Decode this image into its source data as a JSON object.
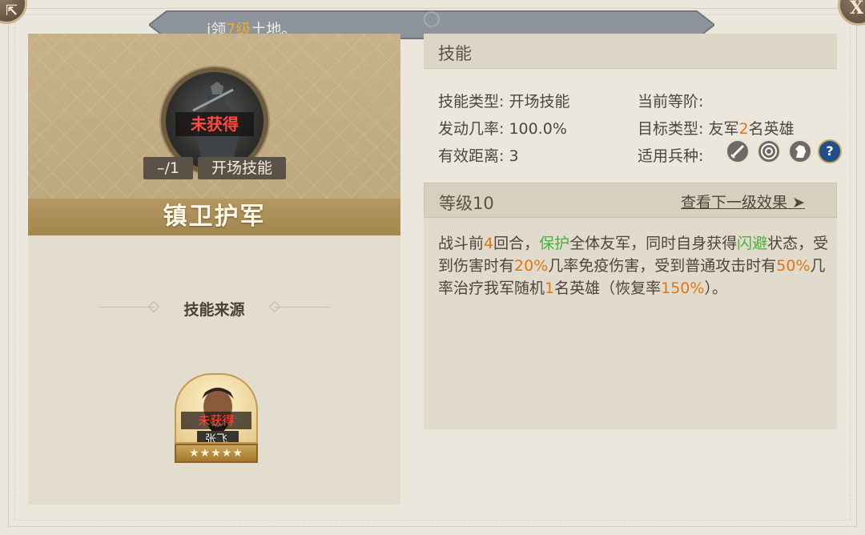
{
  "banner": {
    "prefix": "i领",
    "level": "7级",
    "suffix": "土地。"
  },
  "corner": {
    "left_glyph": "⇱",
    "right_glyph": "X"
  },
  "skill": {
    "name": "镇卫护军",
    "status": "未获得",
    "count": "–/1",
    "type_tag": "开场技能"
  },
  "source": {
    "label": "技能来源",
    "hero": {
      "name": "张飞",
      "status": "未获得",
      "stars": "★★★★★"
    }
  },
  "panel": {
    "header": "技能",
    "skill_type_label": "技能类型:",
    "skill_type_value": "开场技能",
    "rate_label": "发动几率:",
    "rate_value": "100.0%",
    "range_label": "有效距离:",
    "range_value": "3",
    "rank_label": "当前等阶:",
    "target_label": "目标类型:",
    "target_pre": "友军",
    "target_num": "2",
    "target_post": "名英雄",
    "troop_label": "适用兵种:",
    "troop_icons": [
      "sword-icon",
      "target-icon",
      "horse-icon",
      "question-icon"
    ]
  },
  "level": {
    "label": "等级10",
    "next_link": "查看下一级效果 ➤"
  },
  "description": {
    "p1": "战斗前",
    "n1": "4",
    "p2": "回合，",
    "g1": "保护",
    "p3": "全体友军，同时自身获得",
    "g2": "闪避",
    "p4": "状态，受到伤害时有",
    "n2": "20%",
    "p5": "几率免疫伤害，受到普通攻击时有",
    "n3": "50%",
    "p6": "几率治疗我军随机",
    "n4": "1",
    "p7": "名英雄（恢复率",
    "n5": "150%",
    "p8": "）。"
  },
  "colors": {
    "accent": "#e0760f",
    "green": "#4caf3a",
    "red": "#ff4a3c"
  }
}
